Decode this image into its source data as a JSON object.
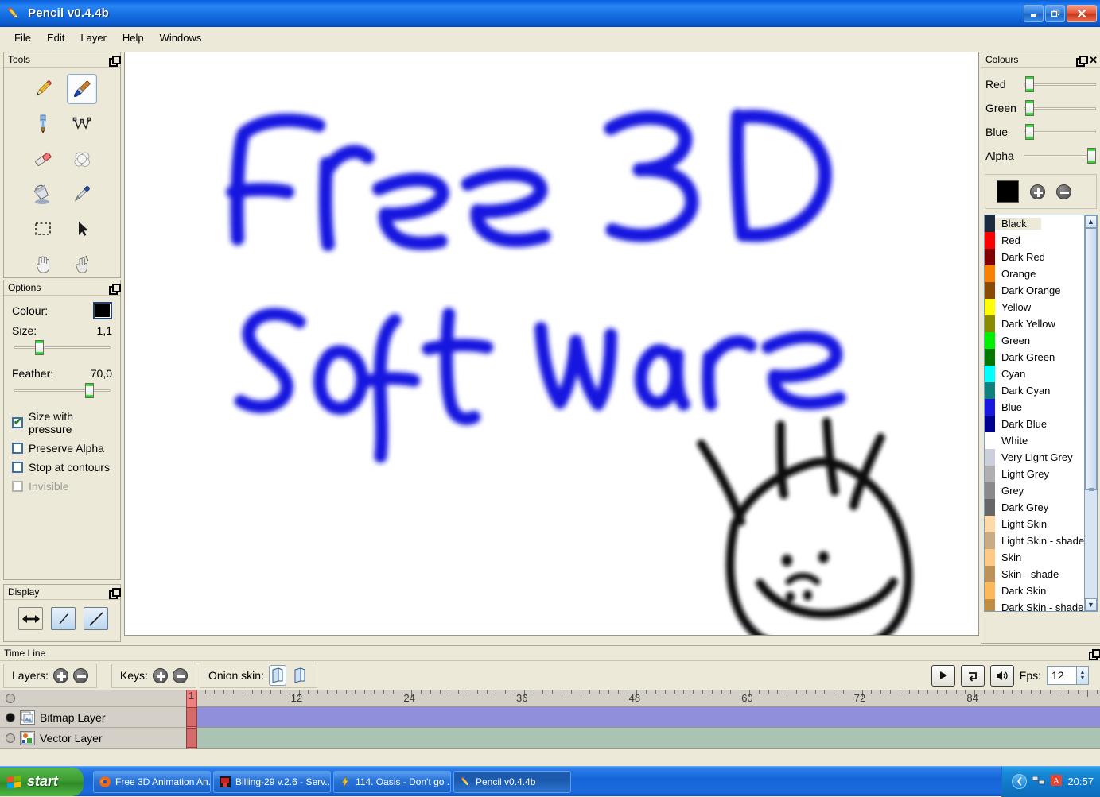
{
  "window": {
    "title": "Pencil v0.4.4b",
    "icon": "pencil-icon",
    "minimize": "_",
    "restore": "❐",
    "close": "✕"
  },
  "menu": {
    "items": [
      "File",
      "Edit",
      "Layer",
      "Help",
      "Windows"
    ]
  },
  "tools_panel": {
    "title": "Tools",
    "items": [
      {
        "name": "pencil-tool",
        "selected": false
      },
      {
        "name": "brush-tool",
        "selected": true
      },
      {
        "name": "pen-tool",
        "selected": false
      },
      {
        "name": "polyline-tool",
        "selected": false
      },
      {
        "name": "eraser-tool",
        "selected": false
      },
      {
        "name": "smudge-tool",
        "selected": false
      },
      {
        "name": "bucket-tool",
        "selected": false
      },
      {
        "name": "eyedropper-tool",
        "selected": false
      },
      {
        "name": "select-tool",
        "selected": false
      },
      {
        "name": "move-tool",
        "selected": false
      },
      {
        "name": "hand-tool",
        "selected": false
      },
      {
        "name": "clip-tool",
        "selected": false
      }
    ]
  },
  "options_panel": {
    "title": "Options",
    "colour_label": "Colour:",
    "colour_value": "#000000",
    "size_label": "Size:",
    "size_value": "1,1",
    "size_percent": 25,
    "feather_label": "Feather:",
    "feather_value": "70,0",
    "feather_percent": 80,
    "checkboxes": [
      {
        "label": "Size with pressure",
        "checked": true,
        "disabled": false
      },
      {
        "label": "Preserve Alpha",
        "checked": false,
        "disabled": false
      },
      {
        "label": "Stop at contours",
        "checked": false,
        "disabled": false
      },
      {
        "label": "Invisible",
        "checked": false,
        "disabled": true
      }
    ]
  },
  "display_panel": {
    "title": "Display",
    "buttons": [
      "horizontal-flip-icon",
      "vertical-flip-icon",
      "angle-icon"
    ]
  },
  "canvas": {
    "background": "#ffffff",
    "drawing_colour": "#1717e0",
    "line1": "Free 3D",
    "line2": "Software",
    "sketch": "smiley-face"
  },
  "colours_panel": {
    "title": "Colours",
    "sliders": [
      {
        "label": "Red",
        "percent": 2
      },
      {
        "label": "Green",
        "percent": 2
      },
      {
        "label": "Blue",
        "percent": 2
      },
      {
        "label": "Alpha",
        "percent": 100
      }
    ],
    "current_swatch": "#000000",
    "add_label": "+",
    "remove_label": "−",
    "list": [
      {
        "name": "Black",
        "hex": "#1b2a3d",
        "selected": true
      },
      {
        "name": "Red",
        "hex": "#fe0000",
        "selected": false
      },
      {
        "name": "Dark Red",
        "hex": "#800000",
        "selected": false
      },
      {
        "name": "Orange",
        "hex": "#fa8000",
        "selected": false
      },
      {
        "name": "Dark Orange",
        "hex": "#8a4a06",
        "selected": false
      },
      {
        "name": "Yellow",
        "hex": "#ffff00",
        "selected": false
      },
      {
        "name": "Dark Yellow",
        "hex": "#8a8a00",
        "selected": false
      },
      {
        "name": "Green",
        "hex": "#00f000",
        "selected": false
      },
      {
        "name": "Dark Green",
        "hex": "#007800",
        "selected": false
      },
      {
        "name": "Cyan",
        "hex": "#00ffff",
        "selected": false
      },
      {
        "name": "Dark Cyan",
        "hex": "#10807e",
        "selected": false
      },
      {
        "name": "Blue",
        "hex": "#1717e0",
        "selected": false
      },
      {
        "name": "Dark Blue",
        "hex": "#00008e",
        "selected": false
      },
      {
        "name": "White",
        "hex": "#ffffff",
        "selected": false
      },
      {
        "name": "Very Light Grey",
        "hex": "#ccd0dc",
        "selected": false
      },
      {
        "name": "Light Grey",
        "hex": "#b0b0b0",
        "selected": false
      },
      {
        "name": "Grey",
        "hex": "#8a8a8a",
        "selected": false
      },
      {
        "name": "Dark Grey",
        "hex": "#666666",
        "selected": false
      },
      {
        "name": "Light Skin",
        "hex": "#ffd9a8",
        "selected": false
      },
      {
        "name": "Light Skin - shade",
        "hex": "#c9ab84",
        "selected": false
      },
      {
        "name": "Skin",
        "hex": "#ffca86",
        "selected": false
      },
      {
        "name": "Skin - shade",
        "hex": "#bd9257",
        "selected": false
      },
      {
        "name": "Dark Skin",
        "hex": "#fdb85c",
        "selected": false
      },
      {
        "name": "Dark Skin - shade",
        "hex": "#c08d42",
        "selected": false
      }
    ]
  },
  "timeline": {
    "title": "Time Line",
    "layers_label": "Layers:",
    "keys_label": "Keys:",
    "onion_label": "Onion skin:",
    "fps_label": "Fps:",
    "fps_value": "12",
    "current_frame": "1",
    "ruler_marks": [
      1,
      12,
      24,
      36,
      48,
      60,
      72,
      84
    ],
    "layers": [
      {
        "name": "Bitmap Layer",
        "icon": "bitmap-layer-icon",
        "visible": true,
        "track": "#8f8fdc"
      },
      {
        "name": "Vector Layer",
        "icon": "vector-layer-icon",
        "visible": false,
        "track": "#a9c4b2"
      }
    ],
    "playback": [
      "play-button",
      "loop-button",
      "sound-button"
    ]
  },
  "taskbar": {
    "start_label": "start",
    "tasks": [
      {
        "label": "Free 3D Animation An...",
        "icon": "firefox-icon",
        "active": false
      },
      {
        "label": "Billing-29 v.2.6 - Serv...",
        "icon": "billing-icon",
        "active": false
      },
      {
        "label": "114. Oasis - Don't go ...",
        "icon": "winamp-icon",
        "active": false
      },
      {
        "label": "Pencil v0.4.4b",
        "icon": "pencil-icon",
        "active": true
      }
    ],
    "tray": {
      "arrow": "❮",
      "icons": [
        "network-icon",
        "app-icon"
      ],
      "time": "20:57"
    }
  }
}
